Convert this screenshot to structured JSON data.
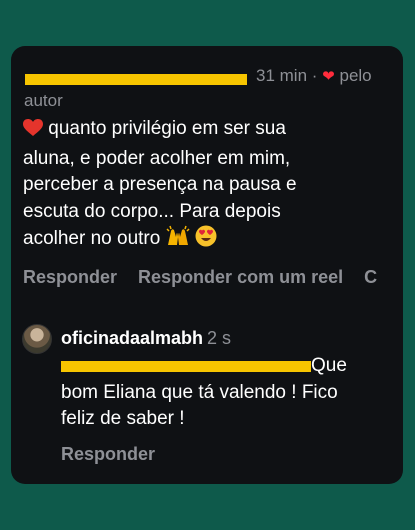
{
  "comment": {
    "time": "31 min",
    "separator": "·",
    "liked_by_author_label": "pelo autor",
    "text_lines": [
      "quanto privilégio em ser sua",
      "aluna, e poder acolher em mim,",
      "perceber a presença na pausa e",
      "escuta do corpo... Para depois",
      "acolher no outro"
    ],
    "actions": [
      "Responder",
      "Responder com um reel",
      "C"
    ]
  },
  "reply": {
    "username": "oficinadaalmabh",
    "time": "2 s",
    "text_line1": "Que",
    "text_line2": "bom Eliana que tá valendo ! Fico",
    "text_line3": "feliz de saber !",
    "action": "Responder"
  },
  "colors": {
    "background": "#0e5a4b",
    "card": "#0f1114",
    "redaction": "#f7c500",
    "muted": "#8e9096",
    "heart": "#ff2c3c",
    "mention": "#7f9fe6"
  }
}
